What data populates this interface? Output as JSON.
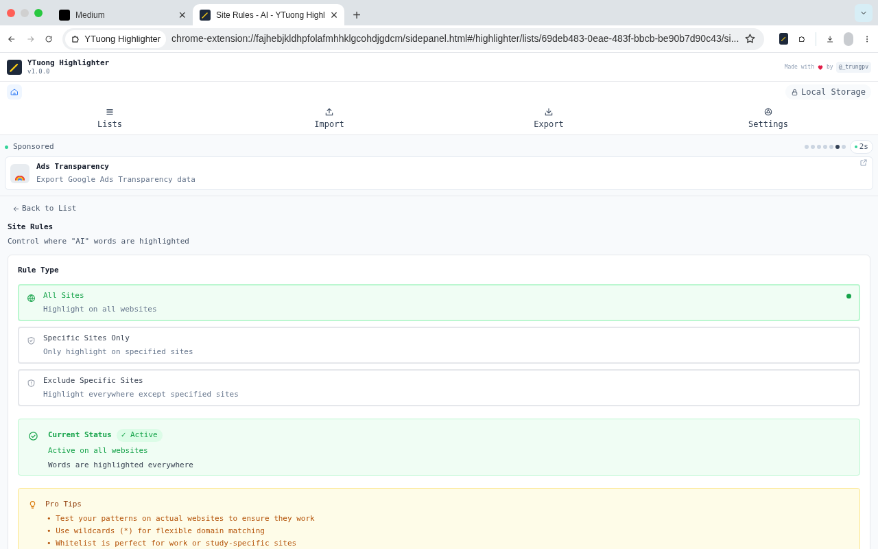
{
  "browser": {
    "tabs": [
      {
        "title": "Medium",
        "selected": false,
        "close": "×"
      },
      {
        "title": "Site Rules - AI - YTuong Highl",
        "selected": true,
        "close": "×"
      }
    ],
    "new_tab": "+",
    "site_chip": "YTuong Highlighter",
    "url": "chrome-extension://fajhebjkldhpfolafmhhklgcohdjgdcm/sidepanel.html#/highlighter/lists/69deb483-0eae-483f-bbcb-be90b7d90c43/si..."
  },
  "app": {
    "name": "YTuong Highlighter",
    "version": "v1.0.0",
    "credit_prefix": "Made with",
    "credit_suffix": "by",
    "handle": "@_trungpv",
    "storage": "Local Storage",
    "nav": [
      {
        "label": "Lists"
      },
      {
        "label": "Import"
      },
      {
        "label": "Export"
      },
      {
        "label": "Settings"
      }
    ],
    "sponsored": {
      "label": "Sponsored",
      "dots": [
        {
          "selected": false
        },
        {
          "selected": false
        },
        {
          "selected": false
        },
        {
          "selected": false
        },
        {
          "selected": false
        },
        {
          "selected": true
        },
        {
          "selected": false
        }
      ],
      "timer": "2s",
      "card": {
        "title": "Ads Transparency",
        "description": "Export Google Ads Transparency data"
      }
    },
    "back": "Back to List",
    "title": "Site Rules",
    "subtitle": "Control where \"AI\" words are highlighted",
    "rule_type": {
      "heading": "Rule Type",
      "options": [
        {
          "title": "All Sites",
          "description": "Highlight on all websites",
          "selected": true
        },
        {
          "title": "Specific Sites Only",
          "description": "Only highlight on specified sites",
          "selected": false
        },
        {
          "title": "Exclude Specific Sites",
          "description": "Highlight everywhere except specified sites",
          "selected": false
        }
      ]
    },
    "status": {
      "title": "Current Status",
      "badge": "✓ Active",
      "line1": "Active on all websites",
      "line2": "Words are highlighted everywhere"
    },
    "tips": {
      "title": "Pro Tips",
      "items": [
        "• Test your patterns on actual websites to ensure they work",
        "• Use wildcards (*) for flexible domain matching",
        "• Whitelist is perfect for work or study-specific sites"
      ]
    }
  }
}
